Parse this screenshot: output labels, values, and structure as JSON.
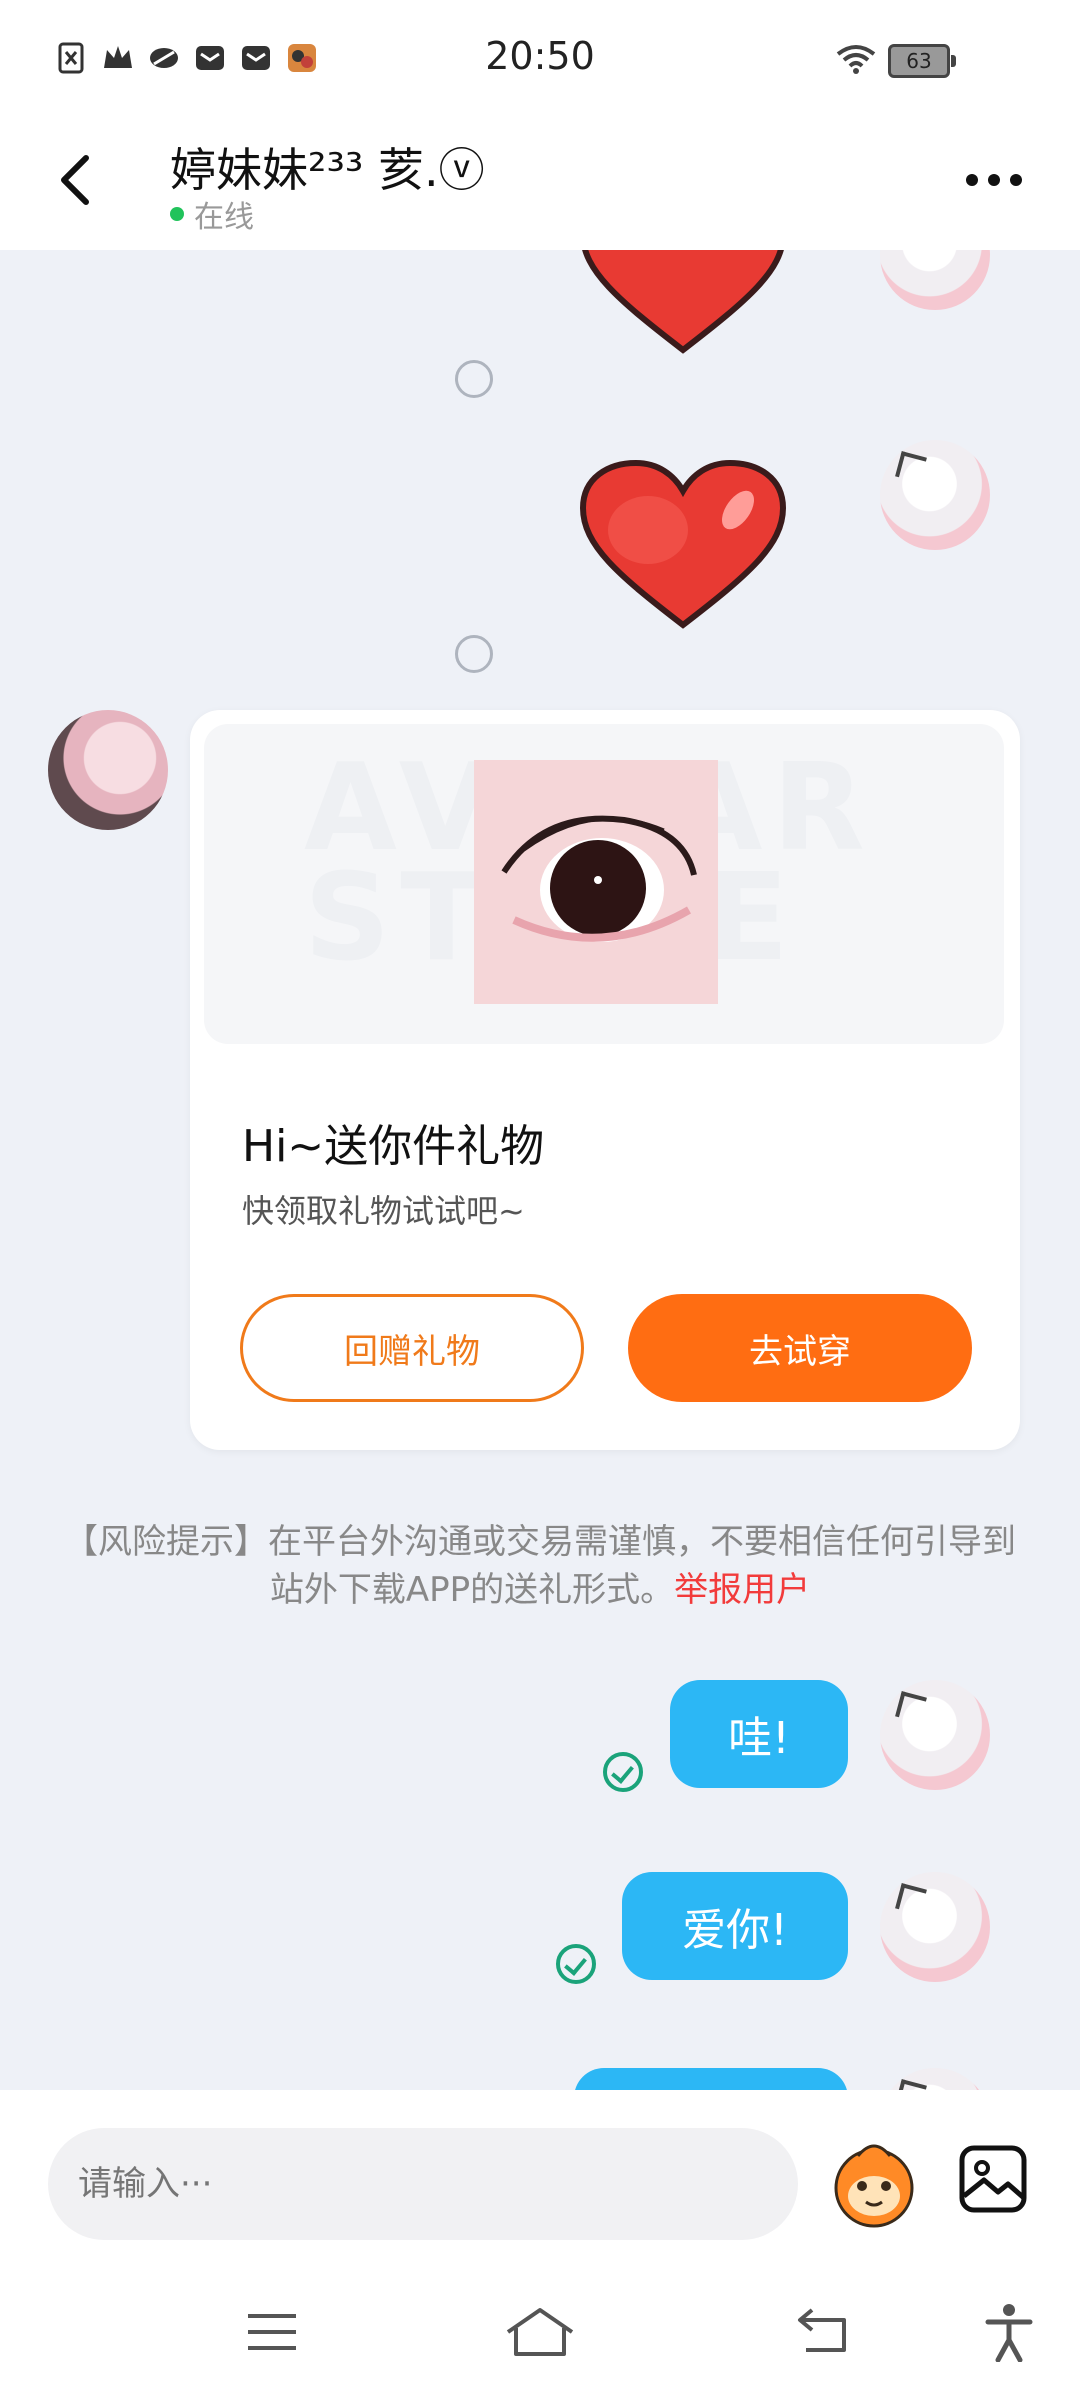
{
  "status_bar": {
    "time": "20:50",
    "battery": "63"
  },
  "header": {
    "title": "婷妹妹²³³ 荄.ⓥ",
    "status": "在线"
  },
  "gift_card": {
    "watermark": "AVATAR STORE",
    "title": "Hi~送你件礼物",
    "subtitle": "快领取礼物试试吧~",
    "return_button": "回赠礼物",
    "try_button": "去试穿"
  },
  "risk_notice": {
    "text": "【风险提示】在平台外沟通或交易需谨慎，不要相信任何引导到站外下载APP的送礼形式。",
    "report_link": "举报用户"
  },
  "messages": [
    {
      "text": "哇!"
    },
    {
      "text": "爱你!"
    }
  ],
  "input": {
    "placeholder": "请输入···"
  },
  "colors": {
    "accent": "#ff6d12",
    "bubble": "#2cb7f5",
    "online": "#21c35b",
    "report": "#f23b3b"
  },
  "icons": [
    "back-arrow-icon",
    "more-icon",
    "heart-sticker",
    "mascot-icon",
    "image-icon",
    "menu-icon",
    "home-icon",
    "back-nav-icon",
    "accessibility-icon"
  ]
}
